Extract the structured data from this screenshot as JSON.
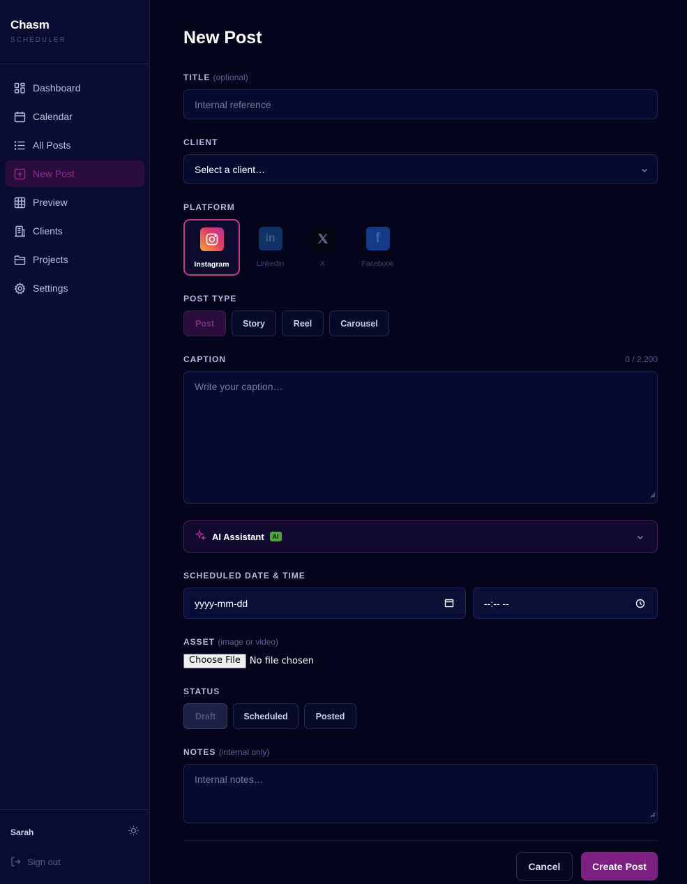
{
  "brand": {
    "name": "Chasm",
    "subtitle": "SCHEDULER"
  },
  "nav": [
    {
      "label": "Dashboard",
      "icon": "dashboard-icon"
    },
    {
      "label": "Calendar",
      "icon": "calendar-icon"
    },
    {
      "label": "All Posts",
      "icon": "list-icon"
    },
    {
      "label": "New Post",
      "icon": "plus-square-icon",
      "active": true
    },
    {
      "label": "Preview",
      "icon": "grid-icon"
    },
    {
      "label": "Clients",
      "icon": "building-icon"
    },
    {
      "label": "Projects",
      "icon": "folder-icon"
    },
    {
      "label": "Settings",
      "icon": "gear-icon"
    }
  ],
  "user": {
    "name": "Sarah",
    "sign_out": "Sign out"
  },
  "page": {
    "title": "New Post"
  },
  "form": {
    "title": {
      "label": "TITLE",
      "hint": "(optional)",
      "placeholder": "Internal reference"
    },
    "client": {
      "label": "CLIENT",
      "value": "Select a client…"
    },
    "platform": {
      "label": "PLATFORM",
      "options": [
        "Instagram",
        "LinkedIn",
        "X",
        "Facebook"
      ],
      "selected": "Instagram"
    },
    "post_type": {
      "label": "POST TYPE",
      "options": [
        "Post",
        "Story",
        "Reel",
        "Carousel"
      ],
      "selected": "Post"
    },
    "caption": {
      "label": "CAPTION",
      "counter": "0 / 2,200",
      "placeholder": "Write your caption…"
    },
    "ai": {
      "label": "AI Assistant",
      "badge": "AI"
    },
    "schedule": {
      "label": "SCHEDULED DATE & TIME",
      "date_placeholder": "yyyy-mm-dd",
      "time_placeholder": "--:-- --"
    },
    "asset": {
      "label": "ASSET",
      "hint": "(image or video)",
      "button": "Choose File",
      "status": "No file chosen"
    },
    "status": {
      "label": "STATUS",
      "options": [
        "Draft",
        "Scheduled",
        "Posted"
      ],
      "selected": "Draft"
    },
    "notes": {
      "label": "NOTES",
      "hint": "(internal only)",
      "placeholder": "Internal notes…"
    }
  },
  "actions": {
    "cancel": "Cancel",
    "create": "Create Post"
  },
  "colors": {
    "accent": "#7e1f83",
    "instagram_border": "#c13d86",
    "background": "#04051a",
    "sidebar": "#0a0d30"
  }
}
